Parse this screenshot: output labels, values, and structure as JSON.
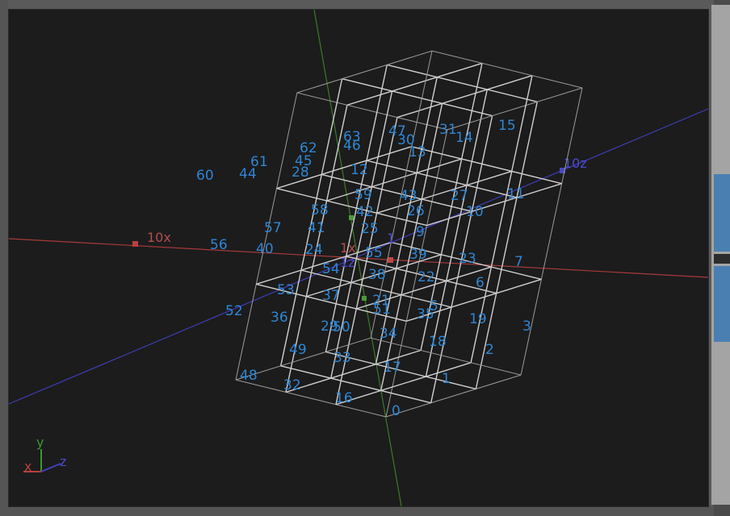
{
  "axes": {
    "x_label": "10x",
    "z_label": "10z",
    "y_label": "1",
    "origin_labels": [
      "1x",
      "1z",
      "1"
    ]
  },
  "gizmo": {
    "x": "x",
    "y": "y",
    "z": "z"
  },
  "vertex_labels": [
    "0",
    "1",
    "2",
    "3",
    "5",
    "6",
    "7",
    "9",
    "10",
    "11",
    "12",
    "13",
    "14",
    "15",
    "16",
    "17",
    "18",
    "19",
    "21",
    "22",
    "23",
    "24",
    "25",
    "26",
    "27",
    "28",
    "29",
    "30",
    "31",
    "32",
    "33",
    "34",
    "35",
    "36",
    "37",
    "38",
    "39",
    "40",
    "41",
    "42",
    "43",
    "44",
    "45",
    "46",
    "47",
    "48",
    "49",
    "50",
    "51",
    "52",
    "53",
    "54",
    "55",
    "56",
    "57",
    "58",
    "59",
    "60",
    "61",
    "62",
    "63"
  ],
  "colors": {
    "background": "#1c1c1c",
    "x_axis": "#a63a3a",
    "y_axis": "#3b7a2a",
    "z_axis": "#3d3db8",
    "label": "#2f86d3",
    "scroll_thumb": "#4a7fb2"
  }
}
